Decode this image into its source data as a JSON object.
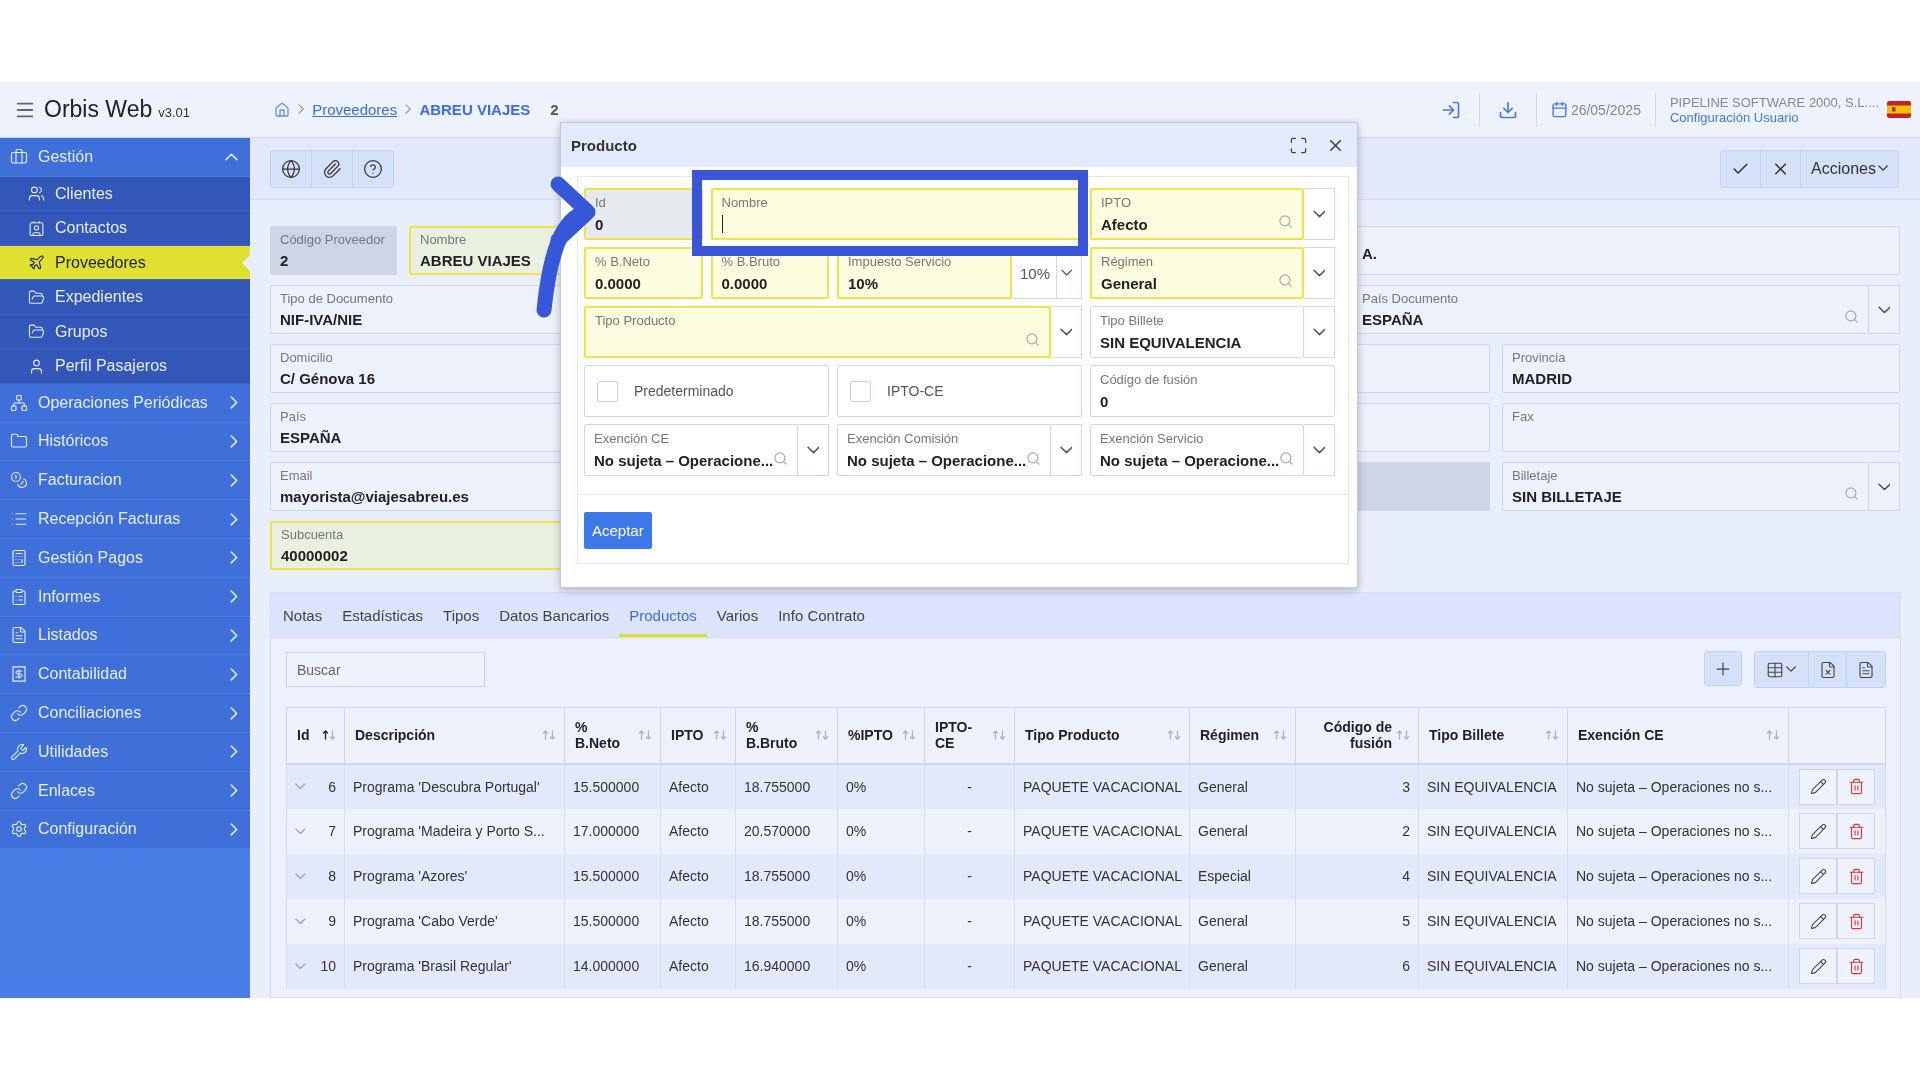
{
  "app": {
    "title": "Orbis Web",
    "version": "v3.01"
  },
  "breadcrumb": {
    "link": "Proveedores",
    "current": "ABREU VIAJES",
    "count": "2"
  },
  "top_bar": {
    "date": "26/05/2025",
    "company": "PIPELINE SOFTWARE 2000, S.L....",
    "user_link": "Configuración Usuario"
  },
  "sidebar": {
    "items": [
      {
        "label": "Gestión",
        "selected": false,
        "expanded": true,
        "children": [
          {
            "label": "Clientes",
            "selected": false
          },
          {
            "label": "Contactos",
            "selected": false
          },
          {
            "label": "Proveedores",
            "selected": true
          },
          {
            "label": "Expedientes",
            "selected": false
          },
          {
            "label": "Grupos",
            "selected": false
          },
          {
            "label": "Perfil Pasajeros",
            "selected": false
          }
        ]
      },
      {
        "label": "Operaciones Periódicas",
        "selected": false,
        "expanded": false
      },
      {
        "label": "Históricos",
        "selected": false,
        "expanded": false
      },
      {
        "label": "Facturacion",
        "selected": false,
        "expanded": false
      },
      {
        "label": "Recepción Facturas",
        "selected": false,
        "expanded": false
      },
      {
        "label": "Gestión Pagos",
        "selected": false,
        "expanded": false
      },
      {
        "label": "Informes",
        "selected": false,
        "expanded": false
      },
      {
        "label": "Listados",
        "selected": false,
        "expanded": false
      },
      {
        "label": "Contabilidad",
        "selected": false,
        "expanded": false
      },
      {
        "label": "Conciliaciones",
        "selected": false,
        "expanded": false
      },
      {
        "label": "Utilidades",
        "selected": false,
        "expanded": false
      },
      {
        "label": "Enlaces",
        "selected": false,
        "expanded": false
      },
      {
        "label": "Configuración",
        "selected": false,
        "expanded": false
      }
    ]
  },
  "toolbar": {
    "actions_label": "Acciones"
  },
  "form": {
    "fields": [
      {
        "label": "Código Proveedor",
        "value": "2",
        "kind": "text",
        "required": false,
        "readonly": true
      },
      {
        "label": "Nombre",
        "value": "ABREU VIAJES",
        "kind": "text",
        "required": true,
        "readonly": false
      },
      {
        "value": "A.",
        "kind": "text",
        "required": false,
        "readonly": false
      },
      {
        "label": "Tipo de Documento",
        "value": "NIF-IVA/NIE",
        "kind": "text",
        "required": false,
        "readonly": false
      },
      {
        "label": "País Documento",
        "value": "ESPAÑA",
        "kind": "lookup",
        "required": false,
        "readonly": false
      },
      {
        "label": "Domicilio",
        "value": "C/ Génova 16",
        "kind": "text",
        "required": false,
        "readonly": false
      },
      {
        "kind": "text",
        "required": false,
        "readonly": false
      },
      {
        "label": "Provincia",
        "value": "MADRID",
        "kind": "text",
        "required": false,
        "readonly": false
      },
      {
        "label": "País",
        "value": "ESPAÑA",
        "kind": "text",
        "required": false,
        "readonly": false
      },
      {
        "kind": "text",
        "required": false,
        "readonly": false
      },
      {
        "label": "Fax",
        "kind": "text",
        "required": false,
        "readonly": false
      },
      {
        "label": "Email",
        "value": "mayorista@viajesabreu.es",
        "kind": "text",
        "required": false,
        "readonly": false
      },
      {
        "kind": "text",
        "required": false,
        "readonly": true
      },
      {
        "label": "Billetaje",
        "value": "SIN BILLETAJE",
        "kind": "lookup",
        "required": false,
        "readonly": false
      },
      {
        "label": "Subcuenta",
        "value": "40000002",
        "kind": "text",
        "required": true,
        "readonly": false
      }
    ]
  },
  "tabs": [
    {
      "label": "Notas",
      "selected": false
    },
    {
      "label": "Estadísticas",
      "selected": false
    },
    {
      "label": "Tipos",
      "selected": false
    },
    {
      "label": "Datos Bancarios",
      "selected": false
    },
    {
      "label": "Productos",
      "selected": true
    },
    {
      "label": "Varios",
      "selected": false
    },
    {
      "label": "Info Contrato",
      "selected": false
    }
  ],
  "products": {
    "search": {
      "placeholder": "Buscar"
    },
    "table": {
      "columns": [
        {
          "label": "Id",
          "sorted": true
        },
        {
          "label": "Descripción",
          "sorted": false
        },
        {
          "label": "% B.Neto",
          "sorted": false
        },
        {
          "label": "IPTO",
          "sorted": false
        },
        {
          "label": "% B.Bruto",
          "sorted": false
        },
        {
          "label": "%IPTO",
          "sorted": false
        },
        {
          "label": "IPTO-CE",
          "sorted": false
        },
        {
          "label": "Tipo Producto",
          "sorted": false
        },
        {
          "label": "Régimen",
          "sorted": false
        },
        {
          "label": "Código de fusión",
          "sorted": false
        },
        {
          "label": "Tipo Billete",
          "sorted": false
        },
        {
          "label": "Exención CE",
          "sorted": false
        }
      ],
      "rows": [
        {
          "expanded": false,
          "cells": [
            "6",
            "Programa 'Descubra Portugal'",
            "15.500000",
            "Afecto",
            "18.755000",
            "0%",
            "-",
            "PAQUETE VACACIONAL",
            "General",
            "3",
            "SIN EQUIVALENCIA",
            "No sujeta – Operaciones no s..."
          ]
        },
        {
          "expanded": false,
          "cells": [
            "7",
            "Programa 'Madeira y Porto S...",
            "17.000000",
            "Afecto",
            "20.570000",
            "0%",
            "-",
            "PAQUETE VACACIONAL",
            "General",
            "2",
            "SIN EQUIVALENCIA",
            "No sujeta – Operaciones no s..."
          ]
        },
        {
          "expanded": false,
          "cells": [
            "8",
            "Programa 'Azores'",
            "15.500000",
            "Afecto",
            "18.755000",
            "0%",
            "-",
            "PAQUETE VACACIONAL",
            "Especial",
            "4",
            "SIN EQUIVALENCIA",
            "No sujeta – Operaciones no s..."
          ]
        },
        {
          "expanded": false,
          "cells": [
            "9",
            "Programa 'Cabo Verde'",
            "15.500000",
            "Afecto",
            "18.755000",
            "0%",
            "-",
            "PAQUETE VACACIONAL",
            "General",
            "5",
            "SIN EQUIVALENCIA",
            "No sujeta – Operaciones no s..."
          ]
        },
        {
          "expanded": false,
          "cells": [
            "10",
            "Programa 'Brasil Regular'",
            "14.000000",
            "Afecto",
            "16.940000",
            "0%",
            "-",
            "PAQUETE VACACIONAL",
            "General",
            "6",
            "SIN EQUIVALENCIA",
            "No sujeta – Operaciones no s..."
          ]
        }
      ]
    }
  },
  "modal": {
    "title": "Producto",
    "accept": "Aceptar",
    "fields": [
      {
        "label": "Id",
        "value": "0",
        "kind": "text",
        "required": true,
        "readonly": true,
        "focused": false
      },
      {
        "label": "Nombre",
        "kind": "text",
        "required": true,
        "readonly": false,
        "focused": true
      },
      {
        "label": "IPTO",
        "value": "Afecto",
        "kind": "lookup",
        "required": true,
        "readonly": false,
        "focused": false
      },
      {
        "label": "% B.Neto",
        "value": "0.0000",
        "kind": "text",
        "required": true,
        "readonly": false,
        "focused": false
      },
      {
        "label": "% B.Bruto",
        "value": "0.0000",
        "kind": "text",
        "required": true,
        "readonly": false,
        "focused": false
      },
      {
        "label": "Impuesto Servicio",
        "value": "10%",
        "unit": "10%",
        "kind": "unit",
        "required": true,
        "readonly": false,
        "focused": false
      },
      {
        "label": "Régimen",
        "value": "General",
        "kind": "lookup",
        "required": true,
        "readonly": false,
        "focused": false
      },
      {
        "label": "Tipo Producto",
        "kind": "lookup",
        "required": true,
        "readonly": false,
        "focused": false
      },
      {
        "label": "Tipo Billete",
        "value": "SIN EQUIVALENCIA",
        "kind": "select",
        "required": false,
        "readonly": false,
        "focused": false
      },
      {
        "label": "Predeterminado",
        "kind": "checkbox",
        "checked": false
      },
      {
        "label": "IPTO-CE",
        "kind": "checkbox",
        "checked": false
      },
      {
        "label": "Código de fusión",
        "value": "0",
        "kind": "text",
        "required": false,
        "readonly": false,
        "focused": false
      },
      {
        "label": "Exención CE",
        "value": "No sujeta – Operacione...",
        "kind": "lookup",
        "required": false,
        "readonly": false,
        "focused": false
      },
      {
        "label": "Exención Comisión",
        "value": "No sujeta – Operacione...",
        "kind": "lookup",
        "required": false,
        "readonly": false,
        "focused": false
      },
      {
        "label": "Exención Servicio",
        "value": "No sujeta – Operacione...",
        "kind": "lookup",
        "required": false,
        "readonly": false,
        "focused": false
      }
    ]
  }
}
